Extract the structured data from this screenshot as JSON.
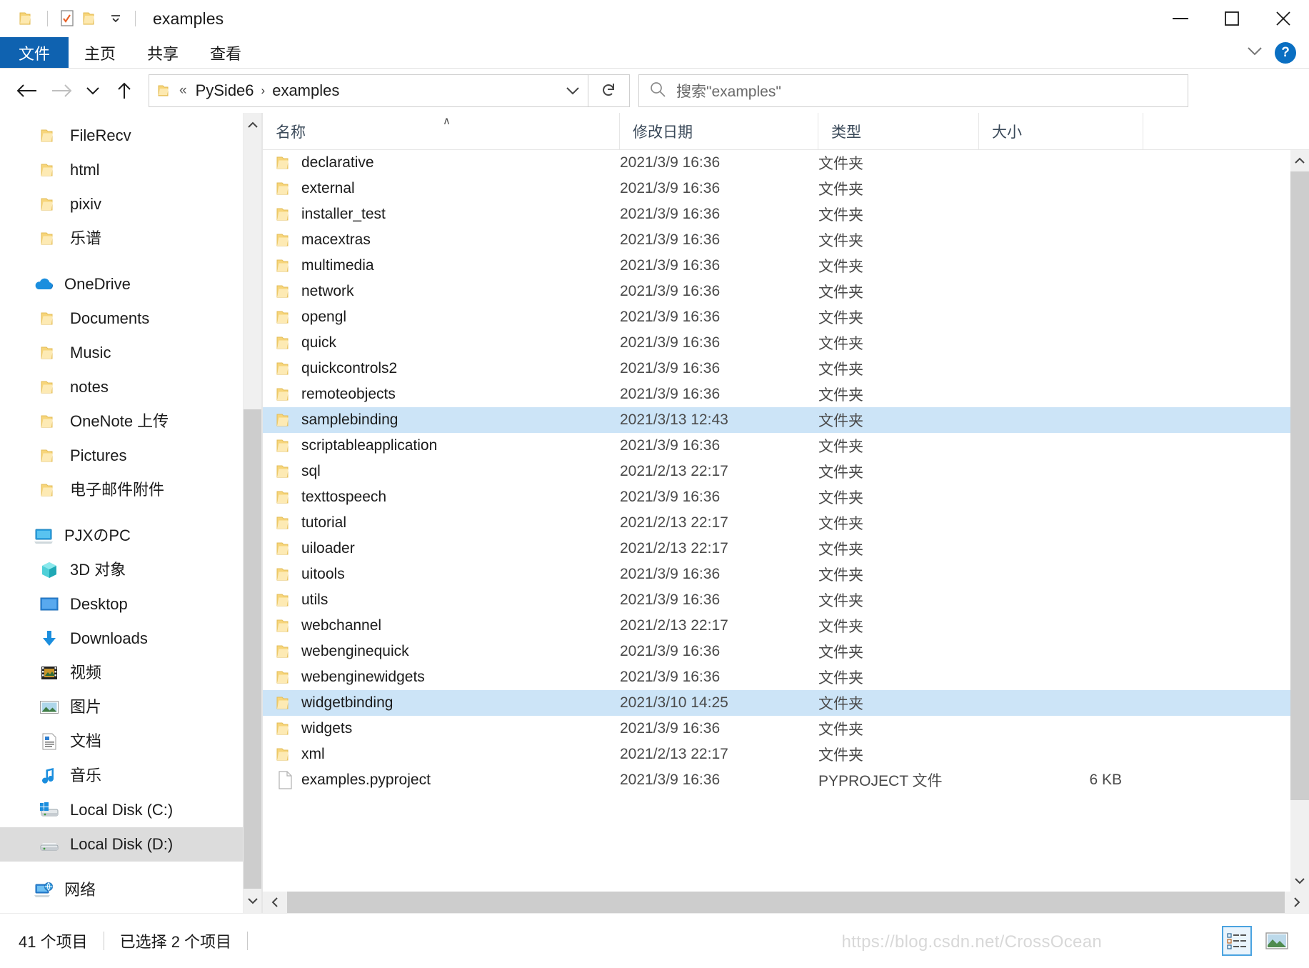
{
  "titlebar": {
    "title": "examples",
    "quick_access": [
      "folder-icon",
      "properties-icon",
      "new-folder-icon",
      "customize-dropdown-icon"
    ],
    "minimize_label": "–",
    "maximize_label": "□",
    "close_label": "×"
  },
  "ribbon": {
    "tabs": [
      {
        "label": "文件",
        "active": true
      },
      {
        "label": "主页",
        "active": false
      },
      {
        "label": "共享",
        "active": false
      },
      {
        "label": "查看",
        "active": false
      }
    ],
    "collapse_icon": "chevron-down-icon",
    "help_label": "?"
  },
  "nav": {
    "back_icon": "arrow-left-icon",
    "forward_icon": "arrow-right-icon",
    "recent_icon": "chevron-down-icon",
    "up_icon": "arrow-up-icon",
    "breadcrumb": {
      "folder_icon": "folder-icon",
      "overflow": "«",
      "parts": [
        "PySide6",
        "examples"
      ],
      "separator": "›",
      "dropdown_icon": "chevron-down-icon"
    },
    "refresh_icon": "refresh-icon",
    "search": {
      "icon": "search-icon",
      "placeholder": "搜索\"examples\"",
      "value": ""
    }
  },
  "sidebar": {
    "groups": [
      {
        "items": [
          {
            "label": "FileRecv",
            "icon": "folder-icon",
            "indent": 1
          },
          {
            "label": "html",
            "icon": "folder-icon",
            "indent": 1
          },
          {
            "label": "pixiv",
            "icon": "folder-icon",
            "indent": 1
          },
          {
            "label": "乐谱",
            "icon": "folder-icon",
            "indent": 1
          }
        ]
      },
      {
        "items": [
          {
            "label": "OneDrive",
            "icon": "onedrive-icon",
            "indent": 0
          },
          {
            "label": "Documents",
            "icon": "folder-icon",
            "indent": 1
          },
          {
            "label": "Music",
            "icon": "folder-icon",
            "indent": 1
          },
          {
            "label": "notes",
            "icon": "folder-icon",
            "indent": 1
          },
          {
            "label": "OneNote 上传",
            "icon": "folder-icon",
            "indent": 1
          },
          {
            "label": "Pictures",
            "icon": "folder-icon",
            "indent": 1
          },
          {
            "label": "电子邮件附件",
            "icon": "folder-icon",
            "indent": 1
          }
        ]
      },
      {
        "items": [
          {
            "label": "PJXのPC",
            "icon": "this-pc-icon",
            "indent": 0
          },
          {
            "label": "3D 对象",
            "icon": "3d-objects-icon",
            "indent": 1
          },
          {
            "label": "Desktop",
            "icon": "desktop-icon",
            "indent": 1
          },
          {
            "label": "Downloads",
            "icon": "downloads-icon",
            "indent": 1
          },
          {
            "label": "视频",
            "icon": "videos-icon",
            "indent": 1
          },
          {
            "label": "图片",
            "icon": "pictures-icon",
            "indent": 1
          },
          {
            "label": "文档",
            "icon": "documents-icon",
            "indent": 1
          },
          {
            "label": "音乐",
            "icon": "music-icon",
            "indent": 1
          },
          {
            "label": "Local Disk (C:)",
            "icon": "windows-drive-icon",
            "indent": 1
          },
          {
            "label": "Local Disk (D:)",
            "icon": "drive-icon",
            "indent": 1,
            "selected": true
          }
        ]
      },
      {
        "items": [
          {
            "label": "网络",
            "icon": "network-icon",
            "indent": 0
          }
        ]
      }
    ]
  },
  "filelist": {
    "columns": [
      {
        "key": "name",
        "label": "名称",
        "sorted": "asc"
      },
      {
        "key": "date",
        "label": "修改日期"
      },
      {
        "key": "type",
        "label": "类型"
      },
      {
        "key": "size",
        "label": "大小"
      }
    ],
    "sort_indicator": "∧",
    "rows": [
      {
        "name": "declarative",
        "date": "2021/3/9 16:36",
        "type": "文件夹",
        "size": "",
        "icon": "folder-icon",
        "selected": false
      },
      {
        "name": "external",
        "date": "2021/3/9 16:36",
        "type": "文件夹",
        "size": "",
        "icon": "folder-icon",
        "selected": false
      },
      {
        "name": "installer_test",
        "date": "2021/3/9 16:36",
        "type": "文件夹",
        "size": "",
        "icon": "folder-icon",
        "selected": false
      },
      {
        "name": "macextras",
        "date": "2021/3/9 16:36",
        "type": "文件夹",
        "size": "",
        "icon": "folder-icon",
        "selected": false
      },
      {
        "name": "multimedia",
        "date": "2021/3/9 16:36",
        "type": "文件夹",
        "size": "",
        "icon": "folder-icon",
        "selected": false
      },
      {
        "name": "network",
        "date": "2021/3/9 16:36",
        "type": "文件夹",
        "size": "",
        "icon": "folder-icon",
        "selected": false
      },
      {
        "name": "opengl",
        "date": "2021/3/9 16:36",
        "type": "文件夹",
        "size": "",
        "icon": "folder-icon",
        "selected": false
      },
      {
        "name": "quick",
        "date": "2021/3/9 16:36",
        "type": "文件夹",
        "size": "",
        "icon": "folder-icon",
        "selected": false
      },
      {
        "name": "quickcontrols2",
        "date": "2021/3/9 16:36",
        "type": "文件夹",
        "size": "",
        "icon": "folder-icon",
        "selected": false
      },
      {
        "name": "remoteobjects",
        "date": "2021/3/9 16:36",
        "type": "文件夹",
        "size": "",
        "icon": "folder-icon",
        "selected": false
      },
      {
        "name": "samplebinding",
        "date": "2021/3/13 12:43",
        "type": "文件夹",
        "size": "",
        "icon": "folder-icon",
        "selected": true
      },
      {
        "name": "scriptableapplication",
        "date": "2021/3/9 16:36",
        "type": "文件夹",
        "size": "",
        "icon": "folder-icon",
        "selected": false
      },
      {
        "name": "sql",
        "date": "2021/2/13 22:17",
        "type": "文件夹",
        "size": "",
        "icon": "folder-icon",
        "selected": false
      },
      {
        "name": "texttospeech",
        "date": "2021/3/9 16:36",
        "type": "文件夹",
        "size": "",
        "icon": "folder-icon",
        "selected": false
      },
      {
        "name": "tutorial",
        "date": "2021/2/13 22:17",
        "type": "文件夹",
        "size": "",
        "icon": "folder-icon",
        "selected": false
      },
      {
        "name": "uiloader",
        "date": "2021/2/13 22:17",
        "type": "文件夹",
        "size": "",
        "icon": "folder-icon",
        "selected": false
      },
      {
        "name": "uitools",
        "date": "2021/3/9 16:36",
        "type": "文件夹",
        "size": "",
        "icon": "folder-icon",
        "selected": false
      },
      {
        "name": "utils",
        "date": "2021/3/9 16:36",
        "type": "文件夹",
        "size": "",
        "icon": "folder-icon",
        "selected": false
      },
      {
        "name": "webchannel",
        "date": "2021/2/13 22:17",
        "type": "文件夹",
        "size": "",
        "icon": "folder-icon",
        "selected": false
      },
      {
        "name": "webenginequick",
        "date": "2021/3/9 16:36",
        "type": "文件夹",
        "size": "",
        "icon": "folder-icon",
        "selected": false
      },
      {
        "name": "webenginewidgets",
        "date": "2021/3/9 16:36",
        "type": "文件夹",
        "size": "",
        "icon": "folder-icon",
        "selected": false
      },
      {
        "name": "widgetbinding",
        "date": "2021/3/10 14:25",
        "type": "文件夹",
        "size": "",
        "icon": "folder-icon",
        "selected": true
      },
      {
        "name": "widgets",
        "date": "2021/3/9 16:36",
        "type": "文件夹",
        "size": "",
        "icon": "folder-icon",
        "selected": false
      },
      {
        "name": "xml",
        "date": "2021/2/13 22:17",
        "type": "文件夹",
        "size": "",
        "icon": "folder-icon",
        "selected": false
      },
      {
        "name": "examples.pyproject",
        "date": "2021/3/9 16:36",
        "type": "PYPROJECT 文件",
        "size": "6 KB",
        "icon": "file-icon",
        "selected": false
      }
    ]
  },
  "statusbar": {
    "item_count": "41 个项目",
    "selection": "已选择 2 个项目",
    "views": [
      {
        "name": "details-view",
        "active": true
      },
      {
        "name": "large-icons-view",
        "active": false
      }
    ]
  },
  "watermark": "https://blog.csdn.net/CrossOcean",
  "colors": {
    "accent": "#0f62b0",
    "selection": "#cce4f7",
    "nav_selection": "#dcdcdc",
    "folder": "#f7d57a",
    "scrollbar_thumb": "#cdcdcd",
    "scrollbar_track": "#f0f0f0"
  }
}
